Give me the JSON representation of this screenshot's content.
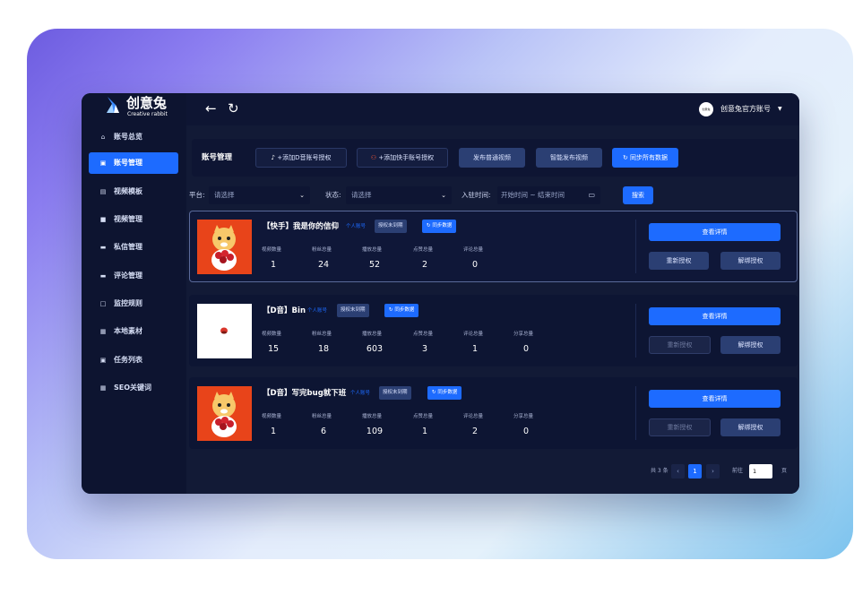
{
  "brand": {
    "name_cn": "创意兔",
    "name_en": "Creative rabbit"
  },
  "sidebar": {
    "items": [
      {
        "icon": "home-icon",
        "glyph": "⌂",
        "label": "账号总览"
      },
      {
        "icon": "account-icon",
        "glyph": "▣",
        "label": "账号管理",
        "active": true
      },
      {
        "icon": "template-icon",
        "glyph": "▤",
        "label": "视频模板"
      },
      {
        "icon": "video-icon",
        "glyph": "■",
        "label": "视频管理"
      },
      {
        "icon": "message-icon",
        "glyph": "▬",
        "label": "私信管理"
      },
      {
        "icon": "comment-icon",
        "glyph": "▬",
        "label": "评论管理"
      },
      {
        "icon": "monitor-icon",
        "glyph": "□",
        "label": "监控规则"
      },
      {
        "icon": "folder-icon",
        "glyph": "▦",
        "label": "本地素材"
      },
      {
        "icon": "task-icon",
        "glyph": "▣",
        "label": "任务列表"
      },
      {
        "icon": "seo-icon",
        "glyph": "▦",
        "label": "SEO关键词"
      }
    ]
  },
  "topbar": {
    "user_name": "创意兔官方账号",
    "avatar_text": "创意兔"
  },
  "toolbar": {
    "title": "账号管理",
    "add_douyin": "+添加D音账号授权",
    "add_kuaishou": "+添加快手账号授权",
    "publish_normal": "发布普通视频",
    "publish_smart": "智能发布视频",
    "sync_all": "同步所有数据"
  },
  "filters": {
    "platform_label": "平台:",
    "platform_value": "请选择",
    "status_label": "状态:",
    "status_value": "请选择",
    "date_label": "入驻时间:",
    "date_value": "开始时间 ~ 结束时间",
    "search_label": "搜索"
  },
  "cards": [
    {
      "title": "【快手】我是你的信仰",
      "tag_personal": "个人账号",
      "tag_auth": "授权未到期",
      "sync_label": "同步数据",
      "stat_labels": [
        "视频数量",
        "粉丝总量",
        "播放总量",
        "点赞总量",
        "评论总量"
      ],
      "stat_values": [
        "1",
        "24",
        "52",
        "2",
        "0"
      ],
      "detail_label": "查看详情",
      "reauth_label": "重新授权",
      "unbind_label": "解绑授权"
    },
    {
      "title": "【D音】Bin",
      "tag_personal": "个人账号",
      "tag_auth": "授权未到期",
      "sync_label": "同步数据",
      "stat_labels": [
        "视频数量",
        "粉丝总量",
        "播放总量",
        "点赞总量",
        "评论总量",
        "分享总量"
      ],
      "stat_values": [
        "15",
        "18",
        "603",
        "3",
        "1",
        "0"
      ],
      "detail_label": "查看详情",
      "reauth_label": "重新授权",
      "unbind_label": "解绑授权"
    },
    {
      "title": "【D音】写完bug就下班",
      "tag_personal": "个人账号",
      "tag_auth": "授权未到期",
      "sync_label": "同步数据",
      "stat_labels": [
        "视频数量",
        "粉丝总量",
        "播放总量",
        "点赞总量",
        "评论总量",
        "分享总量"
      ],
      "stat_values": [
        "1",
        "6",
        "109",
        "1",
        "2",
        "0"
      ],
      "detail_label": "查看详情",
      "reauth_label": "重新授权",
      "unbind_label": "解绑授权"
    }
  ],
  "pagination": {
    "total": "共 3 条",
    "prev": "‹",
    "current_page": "1",
    "next": "›",
    "goto_label": "前往",
    "goto_value": "1",
    "page_unit": "页"
  }
}
